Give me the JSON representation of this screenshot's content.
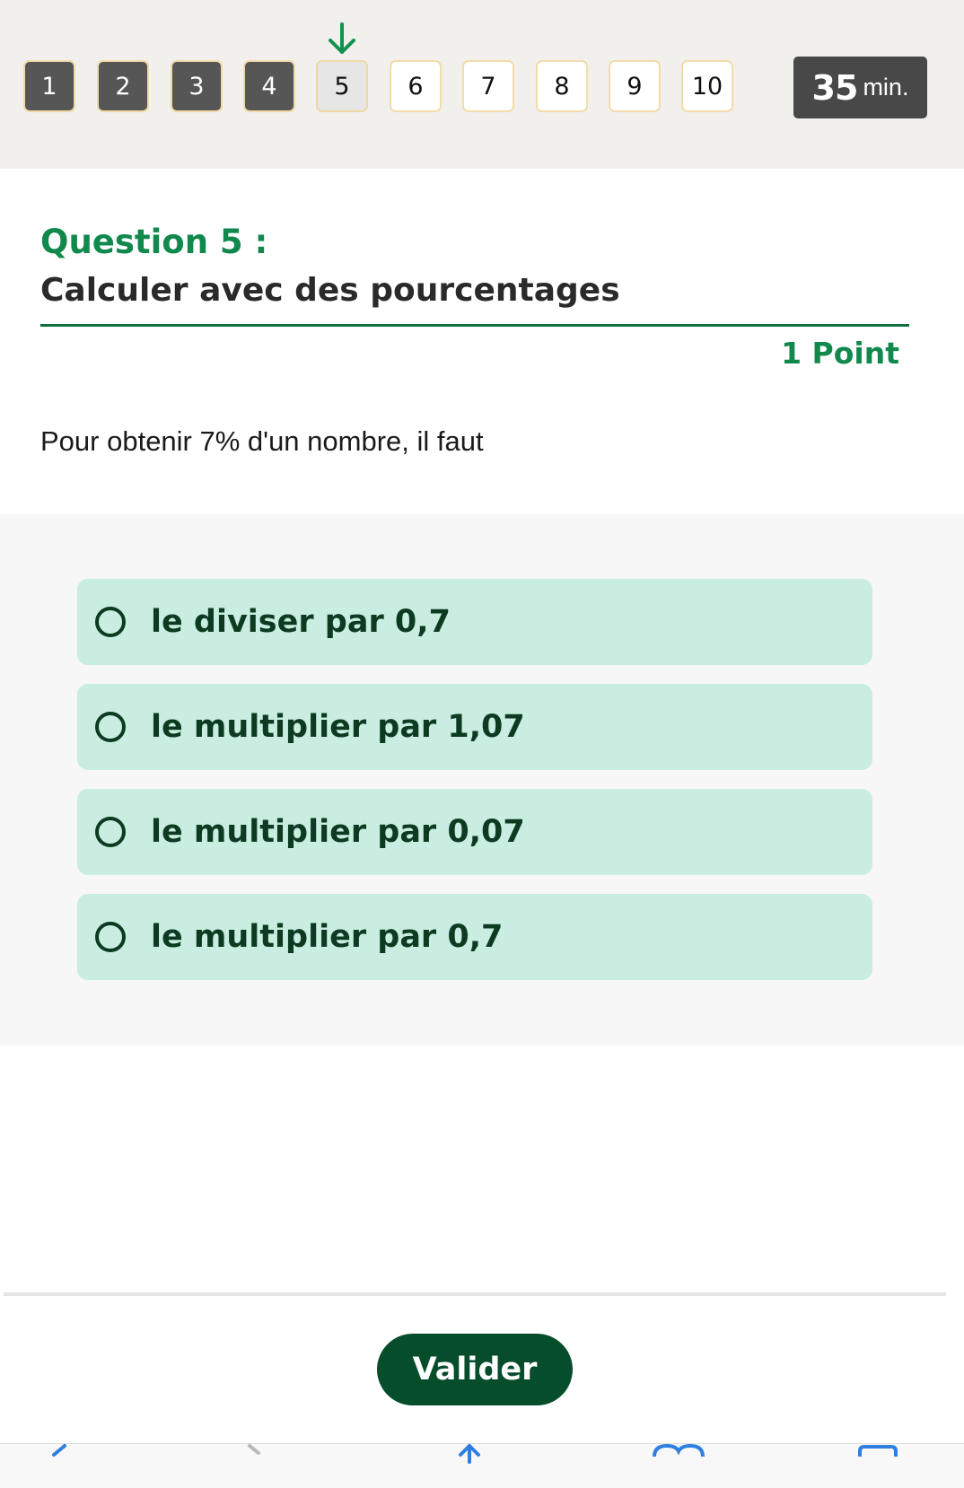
{
  "progress": {
    "current_step": "5",
    "steps": [
      {
        "label": "1",
        "state": "done"
      },
      {
        "label": "2",
        "state": "done"
      },
      {
        "label": "3",
        "state": "done"
      },
      {
        "label": "4",
        "state": "done"
      },
      {
        "label": "5",
        "state": "current"
      },
      {
        "label": "6",
        "state": "todo"
      },
      {
        "label": "7",
        "state": "todo"
      },
      {
        "label": "8",
        "state": "todo"
      },
      {
        "label": "9",
        "state": "todo"
      },
      {
        "label": "10",
        "state": "todo"
      }
    ],
    "current_marker_icon": "arrow-down-icon"
  },
  "timer": {
    "value": "35",
    "unit": "min."
  },
  "question": {
    "label": "Question 5 :",
    "title": "Calculer avec des pourcentages",
    "points": "1 Point",
    "prompt": "Pour obtenir 7% d'un nombre, il faut"
  },
  "answers": [
    {
      "label": "le diviser par 0,7"
    },
    {
      "label": "le multiplier par 1,07"
    },
    {
      "label": "le multiplier par 0,07"
    },
    {
      "label": "le multiplier par 0,7"
    }
  ],
  "submit": {
    "label": "Valider"
  },
  "colors": {
    "accent_green": "#11894d",
    "button_green": "#064d2c",
    "option_bg": "#c9ede0",
    "step_done": "#565656"
  },
  "toolbar_icons": [
    "back-icon",
    "forward-icon",
    "share-icon",
    "bookmarks-icon",
    "tabs-icon"
  ]
}
